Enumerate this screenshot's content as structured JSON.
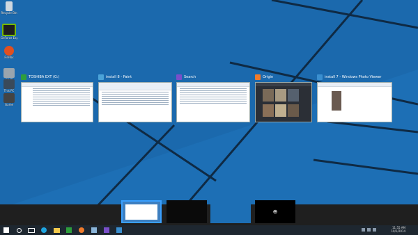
{
  "colors": {
    "wallpaper": "#1d6fb5",
    "taskbar": "#1e2730",
    "strip": "#1f1f1f",
    "accent": "#3aa0ff"
  },
  "desktop_icons": [
    {
      "name": "recycle-bin-icon",
      "label": "Recycle Bin"
    },
    {
      "name": "nvidia-icon",
      "label": "GeForce Experience"
    },
    {
      "name": "firefox-icon",
      "label": "Firefox"
    },
    {
      "name": "folder-icon",
      "label": "Stuff"
    },
    {
      "name": "computer-icon",
      "label": "This PC"
    },
    {
      "name": "game-icon",
      "label": "Game"
    }
  ],
  "windows": [
    {
      "title": "TOSHIBA EXT (G:)",
      "icon": "drive-icon",
      "color": "#2e9e3c"
    },
    {
      "title": "install 8 - Paint",
      "icon": "paint-icon",
      "color": "#4ba3d8"
    },
    {
      "title": "Search",
      "icon": "search-icon",
      "color": "#7a4fc9"
    },
    {
      "title": "Origin",
      "icon": "origin-icon",
      "color": "#f07b2b"
    },
    {
      "title": "install 7 - Windows Photo Viewer",
      "icon": "photo-viewer-icon",
      "color": "#3a8fd0"
    }
  ],
  "desktops": {
    "add_label": "⊕"
  },
  "taskbar": {
    "start_icon": "windows-logo-icon",
    "search_icon": "search-icon"
  },
  "clock": {
    "time": "11:55 AM",
    "date": "10/1/2014"
  }
}
